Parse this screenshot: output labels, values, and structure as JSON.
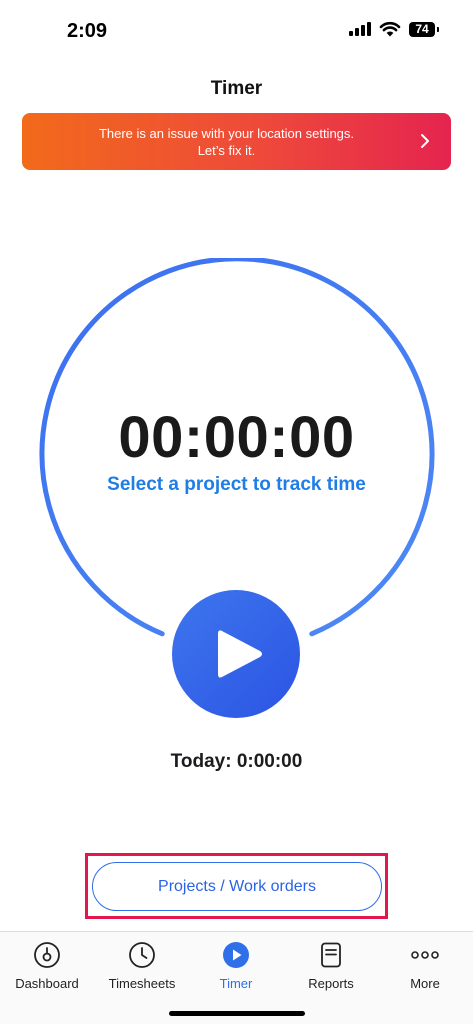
{
  "status_bar": {
    "time": "2:09",
    "battery": "74"
  },
  "header": {
    "title": "Timer"
  },
  "alert": {
    "line1": "There is an issue with your location settings.",
    "line2": "Let’s fix it."
  },
  "timer": {
    "elapsed": "00:00:00",
    "hint": "Select a project to track time",
    "today": "Today: 0:00:00"
  },
  "projects_button": {
    "label": "Projects / Work orders"
  },
  "tabs": [
    {
      "label": "Dashboard",
      "icon": "dashboard-icon"
    },
    {
      "label": "Timesheets",
      "icon": "clock-icon"
    },
    {
      "label": "Timer",
      "icon": "play-circle-icon",
      "active": true
    },
    {
      "label": "Reports",
      "icon": "report-icon"
    },
    {
      "label": "More",
      "icon": "more-dots-icon"
    }
  ],
  "colors": {
    "accent": "#2f6fe8",
    "alert_start": "#f26a1b",
    "alert_end": "#e5244f",
    "highlight": "#e0184f"
  }
}
